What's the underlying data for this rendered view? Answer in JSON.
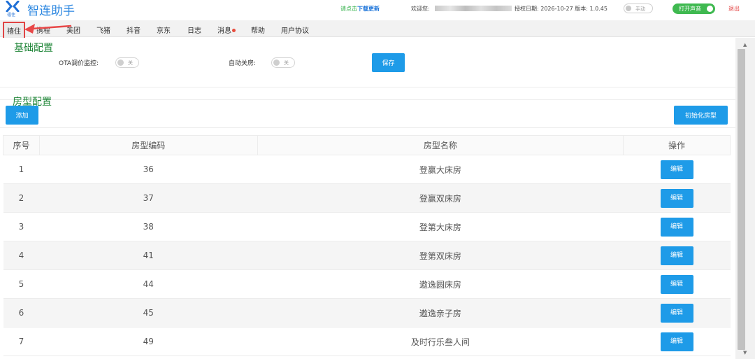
{
  "header": {
    "logo_sub": "禧住",
    "title": "智连助手",
    "download_prefix": "请点击",
    "download_link": "下载更新",
    "welcome": "欢迎您:",
    "auth_text": "授权日期: 2026-10-27  版本: 1.0.45",
    "manual_label": "手动",
    "sound_label": "打开声音",
    "logout": "退出"
  },
  "nav": {
    "items": [
      "禧住",
      "携程",
      "美团",
      "飞猪",
      "抖音",
      "京东",
      "日志",
      "消息",
      "帮助",
      "用户协议"
    ]
  },
  "basic_config": {
    "title": "基础配置",
    "ota_label": "OTA调价监控:",
    "ota_switch": "关",
    "auto_close_label": "自动关房:",
    "auto_close_switch": "关",
    "save_label": "保存"
  },
  "room_config": {
    "title": "房型配置",
    "add_label": "添加",
    "init_label": "初始化房型"
  },
  "table": {
    "headers": [
      "序号",
      "房型编码",
      "房型名称",
      "操作"
    ],
    "edit_label": "编辑",
    "rows": [
      {
        "no": "1",
        "code": "36",
        "name": "登赢大床房"
      },
      {
        "no": "2",
        "code": "37",
        "name": "登赢双床房"
      },
      {
        "no": "3",
        "code": "38",
        "name": "登第大床房"
      },
      {
        "no": "4",
        "code": "41",
        "name": "登第双床房"
      },
      {
        "no": "5",
        "code": "44",
        "name": "遨逸圆床房"
      },
      {
        "no": "6",
        "code": "45",
        "name": "遨逸亲子房"
      },
      {
        "no": "7",
        "code": "49",
        "name": "及时行乐叁人间"
      }
    ]
  },
  "colors": {
    "accent": "#1e9be8",
    "section_title": "#22873a",
    "toggle_on": "#3fb950",
    "logout": "#e23b3b"
  }
}
